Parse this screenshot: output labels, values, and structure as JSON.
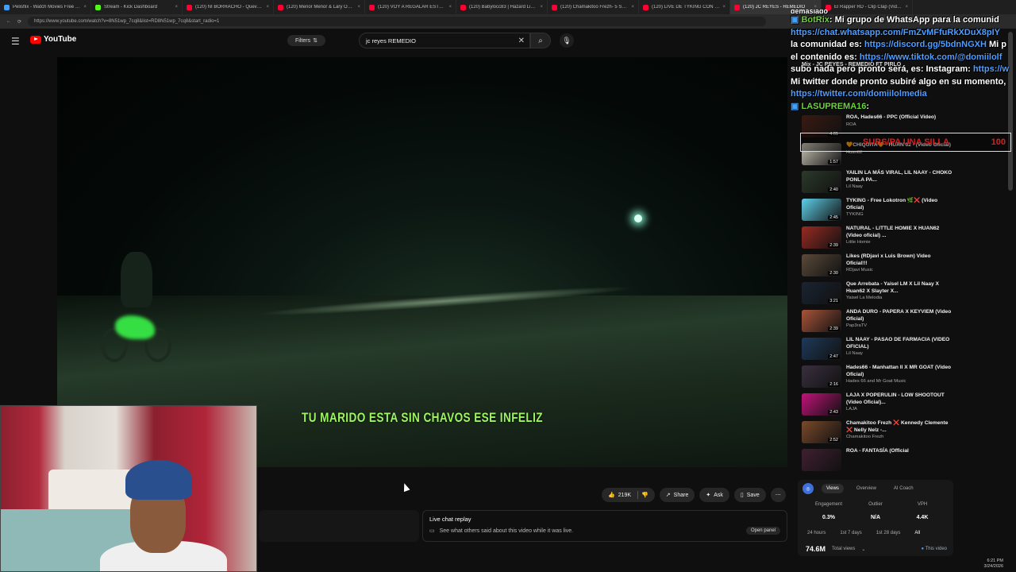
{
  "tabs": [
    {
      "label": "Pelisflix - Watch Movies Free O...",
      "color": "#3fa1ff"
    },
    {
      "label": "Stream - Kick Dashboard",
      "color": "#53fc18"
    },
    {
      "label": "(120) NI BORRACHO - Queved...",
      "color": "#ff0033"
    },
    {
      "label": "(120) Menor Menor & Lary Ove...",
      "color": "#ff0033"
    },
    {
      "label": "(120) VOY A REGALAR ESTO DE...",
      "color": "#ff0033"
    },
    {
      "label": "(120) Babylocc83 | Hazard Light...",
      "color": "#ff0033"
    },
    {
      "label": "(120) Chamakitoo Frezh- 5 STAR...",
      "color": "#ff0033"
    },
    {
      "label": "(120) LIVE DE TYKING CON FLA...",
      "color": "#ff0033"
    },
    {
      "label": "(120) JC REYES - REMEDIO",
      "color": "#ff0033"
    },
    {
      "label": "El Rapper RD - Clip Clap (Video...",
      "color": "#ff0033"
    }
  ],
  "address": {
    "url": "https://www.youtube.com/watch?v=8N51wp_7cq8&list=RD8N51wp_7cq8&start_radio=1"
  },
  "header": {
    "logo": "YouTube",
    "filters": "Filters",
    "search_value": "jc reyes REMEDIO"
  },
  "video": {
    "subtitle": "TU MARIDO ESTA SIN CHAVOS ESE INFELIZ"
  },
  "actions": {
    "likes": "219K",
    "share": "Share",
    "ask": "Ask",
    "save": "Save"
  },
  "livechat": {
    "title": "Live chat replay",
    "desc": "See what others said about this video while it was live.",
    "button": "Open panel"
  },
  "chat": {
    "l0": "demasiado",
    "l1_user": "BotRix",
    "l1_text": ": Mi grupo de WhatsApp para la comunid",
    "l2": "https://chat.whatsapp.com/FmZvMFfuRkXDuX8pIY",
    "l3_text": "la comunidad es: ",
    "l3_link": "https://discord.gg/5bdnNGXH",
    "l3_tail": " Mi p",
    "l4_text": "el contenido es: ",
    "l4_link": "https://www.tiktok.com/@domiilolf",
    "l5_text": "subo nada pero pronto será, es: Instagram: ",
    "l5_link": "https://w",
    "l6": "Mi twitter donde pronto subiré algo en su momento,",
    "l7": "https://twitter.com/domiilolmedia",
    "l8_user": "LASUPREMA16",
    "l8_text": ": "
  },
  "sub_alert": {
    "text": "SUBS/PA UNA SILLA",
    "count": "100"
  },
  "mix": {
    "title": "Mix - JC REYES - REMEDIO FT PIRLO",
    "sub": "Mixes are playlists YouTube makes for you"
  },
  "playlist": [
    {
      "title": "ROA, Hades66 - PPC (Official Video)",
      "channel": "ROA",
      "duration": "4:01",
      "color": "#3a1a12"
    },
    {
      "title": "🧡CHIQUITA🧡 - HUAN 62 - (Video Oficial)",
      "channel": "Huan62",
      "duration": "1:57",
      "color": "#c8c3b5"
    },
    {
      "title": "YAILIN LA MÁS VIRAL, LIL NAAY - CHOKO PONLA PA...",
      "channel": "Lil Naay",
      "duration": "2:40",
      "color": "#2b3a2a"
    },
    {
      "title": "TYKING - Free Lokotron 🌿❌ (Video Oficial)",
      "channel": "TYKING",
      "duration": "2:45",
      "color": "#5ed0e8"
    },
    {
      "title": "NATURAL - LITTLE HOMIE X HUAN62 (Video oficial) ...",
      "channel": "Little Homie",
      "duration": "2:39",
      "color": "#9a2b22"
    },
    {
      "title": "Likes (RDjavi x Luis Brown) Video Oficial!!!",
      "channel": "RDjavi Music",
      "duration": "2:30",
      "color": "#5a4a3a"
    },
    {
      "title": "Que Arrebata - Yaisel LM X Lil Naay X Huan62 X Slayter X...",
      "channel": "Yaisel La Melodia",
      "duration": "3:21",
      "color": "#1a2432"
    },
    {
      "title": "ANDA DURO - PAPERA X KEYVIEM (Video Oficial)",
      "channel": "Pap3raTV",
      "duration": "2:39",
      "color": "#a8543a"
    },
    {
      "title": "LIL NAAY - PASAO DE FARMACIA (VIDEO OFICIAL)",
      "channel": "Lil Naay",
      "duration": "2:47",
      "color": "#1e3a5a"
    },
    {
      "title": "Hades66 - Manhattan II X MR GOAT (Video Oficial)",
      "channel": "Hades 66 and Mr Goat Music",
      "duration": "2:16",
      "color": "#3a3040"
    },
    {
      "title": "LAJA X POPERULIN - LOW SHOOTOUT (Video Oficial)...",
      "channel": "LAJA",
      "duration": "2:43",
      "color": "#c2127a"
    },
    {
      "title": "Chamakitoo Frezh ❌ Kennedy Clemente ❌ Nelly Nelz -...",
      "channel": "Chamakitoo Frezh",
      "duration": "2:52",
      "color": "#7a4a2a"
    },
    {
      "title": "ROA - FANTASÍA (Official",
      "channel": "",
      "duration": "",
      "color": "#402030"
    }
  ],
  "stats": {
    "tabs": [
      "Views",
      "Overview",
      "AI Coach"
    ],
    "headers": [
      "Engagement",
      "Outlier",
      "VPH"
    ],
    "values": [
      "0.3%",
      "N/A",
      "4.4K"
    ],
    "periods": [
      "24 hours",
      "1st 7 days",
      "1st 28 days",
      "All"
    ],
    "total": "74.6M",
    "total_label": "Total views",
    "this_video": "This video"
  },
  "clock": {
    "time": "6:21 PM",
    "date": "3/24/2026"
  }
}
